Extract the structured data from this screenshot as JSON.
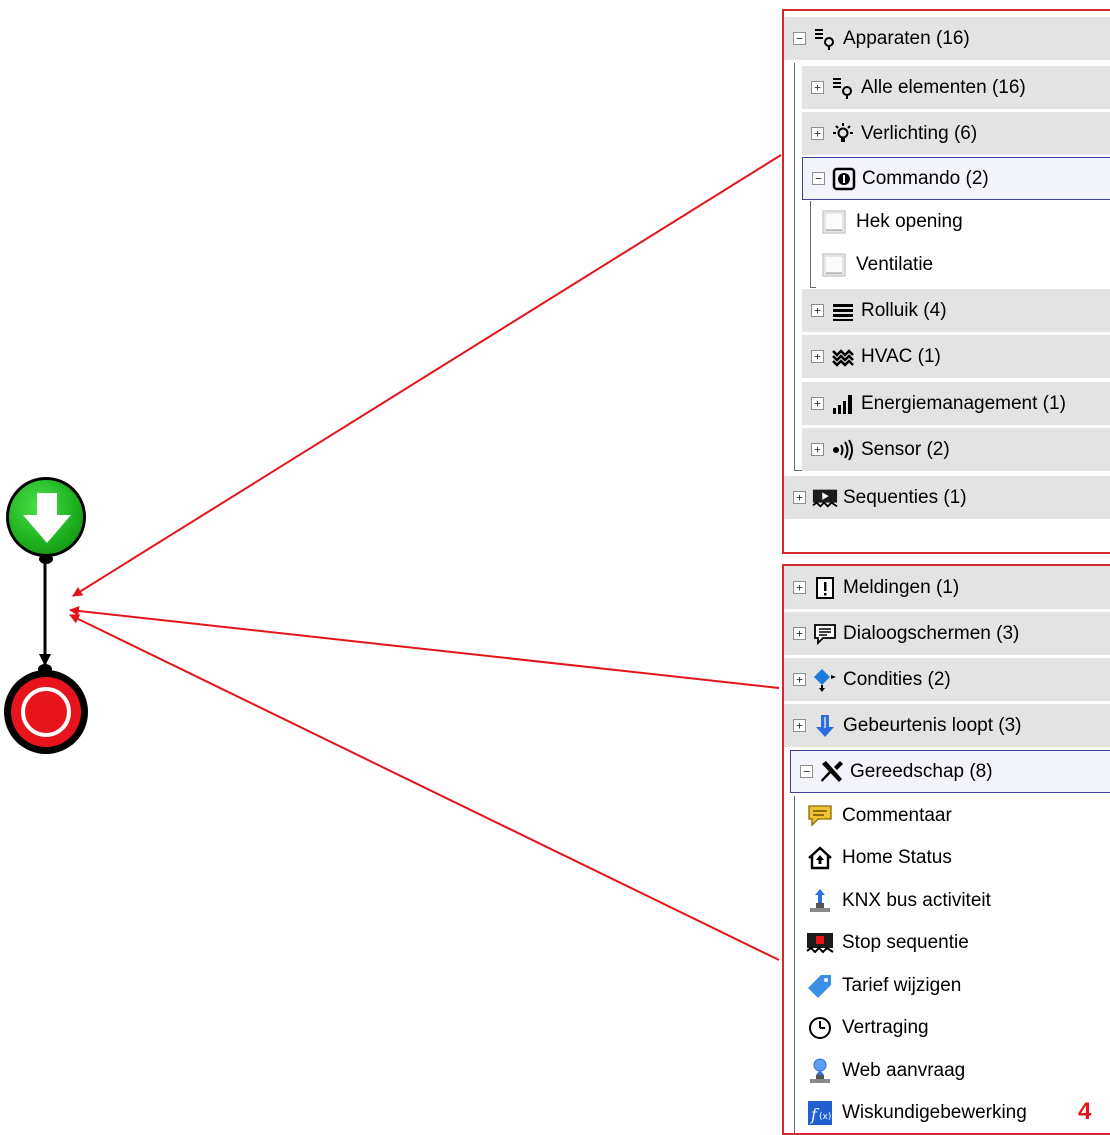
{
  "devices_panel": {
    "root": {
      "toggle": "−",
      "label": "Apparaten (16)"
    },
    "categories": [
      {
        "toggle": "+",
        "label": "Alle elementen (16)",
        "icon": "device-list-icon"
      },
      {
        "toggle": "+",
        "label": "Verlichting (6)",
        "icon": "light-bulb-icon"
      },
      {
        "toggle": "−",
        "label": "Commando (2)",
        "icon": "command-icon",
        "selected": true
      }
    ],
    "commando_items": [
      {
        "label": "Hek opening",
        "icon": "switch-icon"
      },
      {
        "label": "Ventilatie",
        "icon": "switch-icon"
      }
    ],
    "more_categories": [
      {
        "toggle": "+",
        "label": "Rolluik (4)",
        "icon": "shutter-icon"
      },
      {
        "toggle": "+",
        "label": "HVAC (1)",
        "icon": "hvac-icon"
      },
      {
        "toggle": "+",
        "label": "Energiemanagement (1)",
        "icon": "energy-bars-icon"
      },
      {
        "toggle": "+",
        "label": "Sensor (2)",
        "icon": "sensor-icon"
      }
    ],
    "sequences": {
      "toggle": "+",
      "label": "Sequenties (1)",
      "icon": "sequence-icon"
    }
  },
  "tools_panel": {
    "groups": [
      {
        "toggle": "+",
        "label": "Meldingen (1)",
        "icon": "notification-icon"
      },
      {
        "toggle": "+",
        "label": "Dialoogschermen (3)",
        "icon": "dialog-icon"
      },
      {
        "toggle": "+",
        "label": "Condities (2)",
        "icon": "condition-icon"
      },
      {
        "toggle": "+",
        "label": "Gebeurtenis loopt (3)",
        "icon": "event-arrow-icon"
      },
      {
        "toggle": "−",
        "label": "Gereedschap (8)",
        "icon": "tools-icon",
        "selected": true
      }
    ],
    "tools": [
      {
        "label": "Commentaar",
        "icon": "comment-icon"
      },
      {
        "label": "Home Status",
        "icon": "home-status-icon"
      },
      {
        "label": "KNX bus activiteit",
        "icon": "knx-bus-icon"
      },
      {
        "label": "Stop sequentie",
        "icon": "stop-sequence-icon"
      },
      {
        "label": "Tarief wijzigen",
        "icon": "tariff-tag-icon"
      },
      {
        "label": "Vertraging",
        "icon": "clock-icon"
      },
      {
        "label": "Web aanvraag",
        "icon": "web-request-icon"
      },
      {
        "label": "Wiskundigebewerking",
        "icon": "math-function-icon"
      }
    ]
  },
  "step_number": "4",
  "colors": {
    "annotation": "#e3141b",
    "start": "#1fb21f",
    "stop": "#e8141c",
    "row_bg": "#e3e3e3",
    "selection_border": "#3f3f9f"
  }
}
